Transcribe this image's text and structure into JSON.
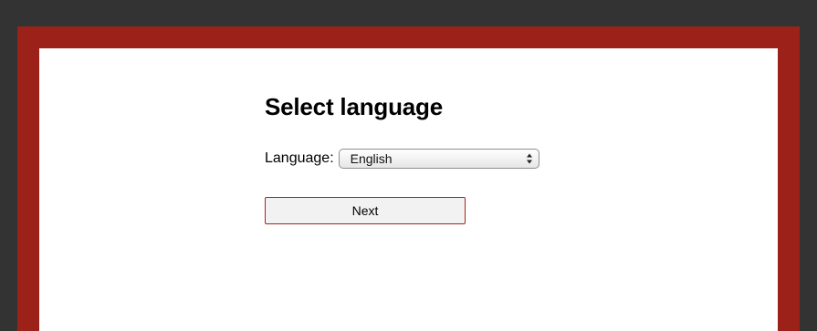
{
  "page": {
    "title": "Select language"
  },
  "form": {
    "language_label": "Language:",
    "language_select": {
      "selected": "English"
    },
    "next_label": "Next"
  },
  "colors": {
    "frame_outer": "#333333",
    "frame_accent": "#9b2119",
    "panel": "#ffffff",
    "button_border": "#a8241c",
    "button_fill": "#f2f2f2"
  },
  "icons": {
    "select_arrows": "updown-chevron-icon"
  }
}
